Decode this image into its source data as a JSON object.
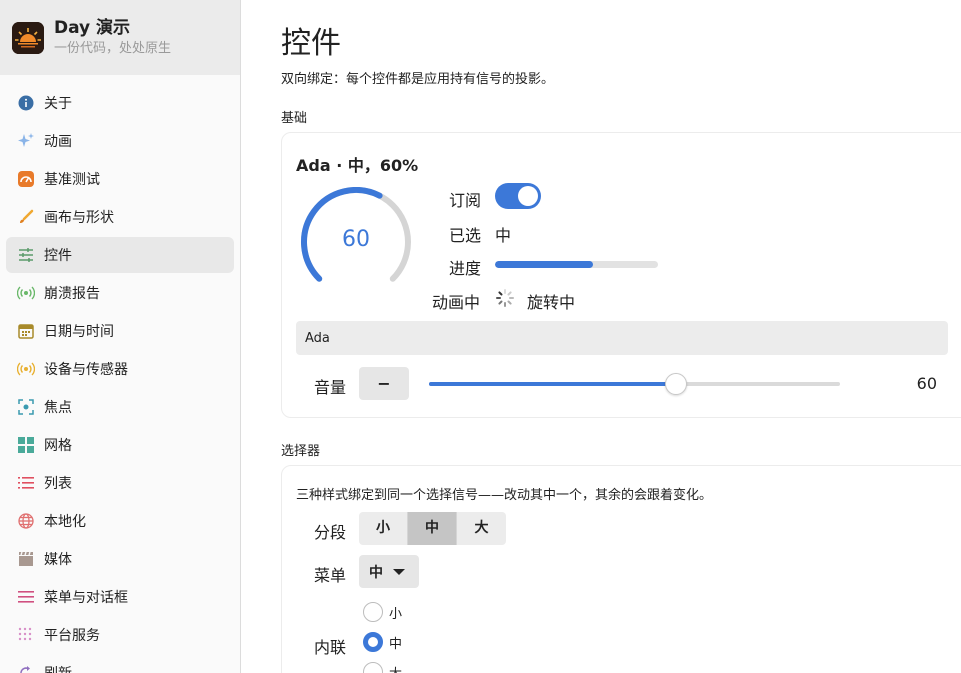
{
  "brand": {
    "title": "Day 演示",
    "subtitle": "一份代码，处处原生"
  },
  "sidebar": {
    "items": [
      {
        "label": "关于",
        "icon": "info-icon",
        "color": "#3a6ea5"
      },
      {
        "label": "动画",
        "icon": "sparkles-icon",
        "color": "#8ab4e8"
      },
      {
        "label": "基准测试",
        "icon": "speedometer-icon",
        "color": "#e87a2a"
      },
      {
        "label": "画布与形状",
        "icon": "brush-icon",
        "color": "#f0a830"
      },
      {
        "label": "控件",
        "icon": "sliders-icon",
        "color": "#5a9a6a"
      },
      {
        "label": "崩溃报告",
        "icon": "broadcast-icon",
        "color": "#6ab86a"
      },
      {
        "label": "日期与时间",
        "icon": "calendar-icon",
        "color": "#a88a2a"
      },
      {
        "label": "设备与传感器",
        "icon": "sensor-icon",
        "color": "#e8b030"
      },
      {
        "label": "焦点",
        "icon": "focus-icon",
        "color": "#3a9ab0"
      },
      {
        "label": "网格",
        "icon": "grid-icon",
        "color": "#4aaa9a"
      },
      {
        "label": "列表",
        "icon": "list-icon",
        "color": "#e05060"
      },
      {
        "label": "本地化",
        "icon": "globe-icon",
        "color": "#e07070"
      },
      {
        "label": "媒体",
        "icon": "clapper-icon",
        "color": "#a89890"
      },
      {
        "label": "菜单与对话框",
        "icon": "menu-icon",
        "color": "#d05080"
      },
      {
        "label": "平台服务",
        "icon": "dots-grid-icon",
        "color": "#d890c8"
      },
      {
        "label": "刷新",
        "icon": "refresh-icon",
        "color": "#9070c0"
      }
    ],
    "active_index": 4
  },
  "page": {
    "title": "控件",
    "subtitle": "双向绑定：每个控件都是应用持有信号的投影。"
  },
  "basics": {
    "section_label": "基础",
    "card_title": "Ada · 中，60%",
    "gauge_value": "60",
    "gauge_fraction": 0.6,
    "subscribe_label": "订阅",
    "subscribe_on": true,
    "selected_label": "已选",
    "selected_value": "中",
    "progress_label": "进度",
    "progress_fraction": 0.6,
    "animating_label": "动画中",
    "animating_value": "旋转中",
    "name_value": "Ada",
    "volume_label": "音量",
    "volume_minus": "−",
    "volume_value": "60",
    "volume_fraction": 0.6,
    "accent": "#3c78d8"
  },
  "pickers": {
    "section_label": "选择器",
    "description": "三种样式绑定到同一个选择信号——改动其中一个，其余的会跟着变化。",
    "segment_label": "分段",
    "segments": [
      "小",
      "中",
      "大"
    ],
    "segment_selected": 1,
    "menu_label": "菜单",
    "menu_value": "中",
    "inline_label": "内联",
    "radios": [
      "小",
      "中",
      "大"
    ],
    "radio_selected": 1
  }
}
